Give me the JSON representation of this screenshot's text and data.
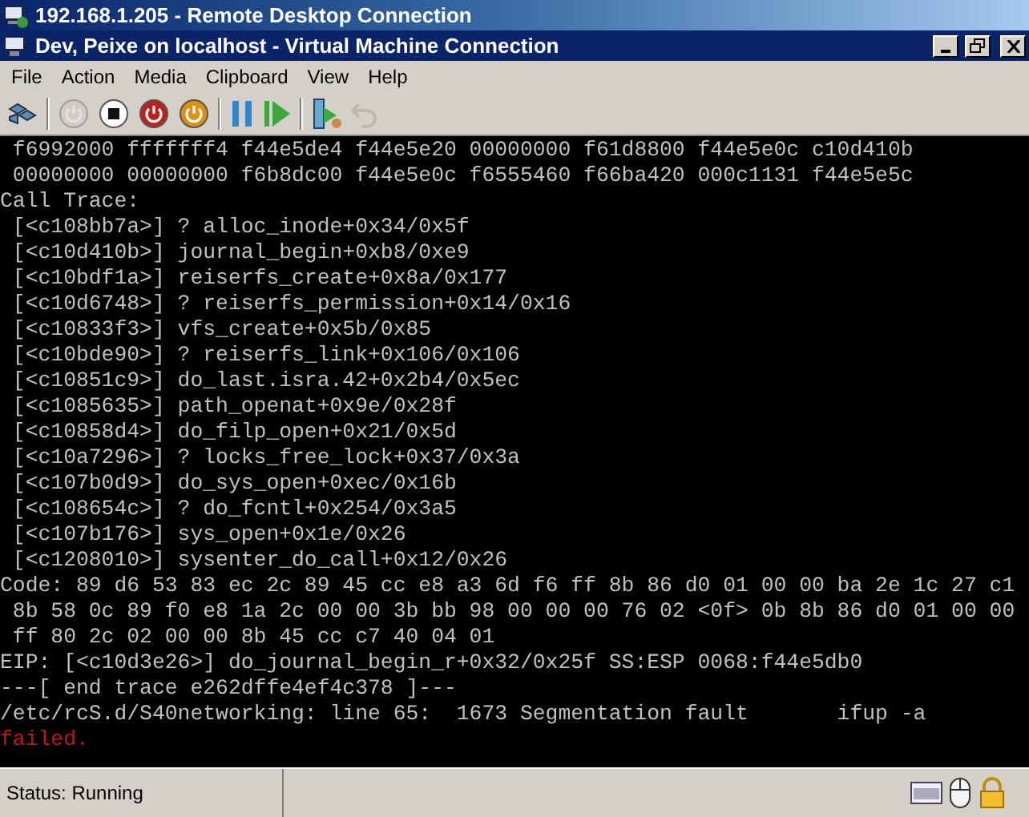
{
  "outer_window": {
    "title": "192.168.1.205 - Remote Desktop Connection"
  },
  "window": {
    "title": "Dev, Peixe on localhost - Virtual Machine Connection"
  },
  "menu": [
    "File",
    "Action",
    "Media",
    "Clipboard",
    "View",
    "Help"
  ],
  "toolbar": [
    {
      "kind": "ctrl-alt-del",
      "disabled": false
    },
    {
      "kind": "separator"
    },
    {
      "kind": "start",
      "disabled": true
    },
    {
      "kind": "turn-off",
      "disabled": false
    },
    {
      "kind": "shut-down",
      "disabled": false
    },
    {
      "kind": "save",
      "disabled": false
    },
    {
      "kind": "separator"
    },
    {
      "kind": "pause",
      "disabled": false
    },
    {
      "kind": "reset",
      "disabled": false
    },
    {
      "kind": "separator"
    },
    {
      "kind": "snapshot",
      "disabled": false
    },
    {
      "kind": "revert",
      "disabled": true
    }
  ],
  "console": {
    "lines": [
      {
        "kind": "normal",
        "text": " f6992000 fffffff4 f44e5de4 f44e5e20 00000000 f61d8800 f44e5e0c c10d410b"
      },
      {
        "kind": "normal",
        "text": " 00000000 00000000 f6b8dc00 f44e5e0c f6555460 f66ba420 000c1131 f44e5e5c"
      },
      {
        "kind": "normal",
        "text": "Call Trace:"
      },
      {
        "kind": "normal",
        "text": " [<c108bb7a>] ? alloc_inode+0x34/0x5f"
      },
      {
        "kind": "normal",
        "text": " [<c10d410b>] journal_begin+0xb8/0xe9"
      },
      {
        "kind": "normal",
        "text": " [<c10bdf1a>] reiserfs_create+0x8a/0x177"
      },
      {
        "kind": "normal",
        "text": " [<c10d6748>] ? reiserfs_permission+0x14/0x16"
      },
      {
        "kind": "normal",
        "text": " [<c10833f3>] vfs_create+0x5b/0x85"
      },
      {
        "kind": "normal",
        "text": " [<c10bde90>] ? reiserfs_link+0x106/0x106"
      },
      {
        "kind": "normal",
        "text": " [<c10851c9>] do_last.isra.42+0x2b4/0x5ec"
      },
      {
        "kind": "normal",
        "text": " [<c1085635>] path_openat+0x9e/0x28f"
      },
      {
        "kind": "normal",
        "text": " [<c10858d4>] do_filp_open+0x21/0x5d"
      },
      {
        "kind": "normal",
        "text": " [<c10a7296>] ? locks_free_lock+0x37/0x3a"
      },
      {
        "kind": "normal",
        "text": " [<c107b0d9>] do_sys_open+0xec/0x16b"
      },
      {
        "kind": "normal",
        "text": " [<c108654c>] ? do_fcntl+0x254/0x3a5"
      },
      {
        "kind": "normal",
        "text": " [<c107b176>] sys_open+0x1e/0x26"
      },
      {
        "kind": "normal",
        "text": " [<c1208010>] sysenter_do_call+0x12/0x26"
      },
      {
        "kind": "normal",
        "text": "Code: 89 d6 53 83 ec 2c 89 45 cc e8 a3 6d f6 ff 8b 86 d0 01 00 00 ba 2e 1c 27 c1"
      },
      {
        "kind": "normal",
        "text": " 8b 58 0c 89 f0 e8 1a 2c 00 00 3b bb 98 00 00 00 76 02 <0f> 0b 8b 86 d0 01 00 00"
      },
      {
        "kind": "normal",
        "text": " ff 80 2c 02 00 00 8b 45 cc c7 40 04 01"
      },
      {
        "kind": "normal",
        "text": "EIP: [<c10d3e26>] do_journal_begin_r+0x32/0x25f SS:ESP 0068:f44e5db0"
      },
      {
        "kind": "normal",
        "text": "---[ end trace e262dffe4ef4c378 ]---"
      },
      {
        "kind": "normal",
        "text": "/etc/rcS.d/S40networking: line 65:  1673 Segmentation fault       ifup -a"
      },
      {
        "kind": "error",
        "text": "failed."
      }
    ]
  },
  "status_bar": {
    "text": "Status: Running"
  }
}
